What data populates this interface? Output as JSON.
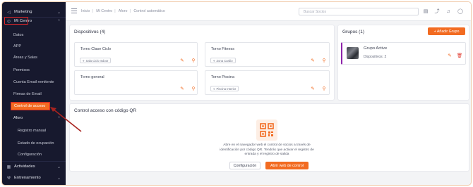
{
  "sidebar": {
    "marketing": "Marketing",
    "mi_centro": "Mi Centro",
    "items": [
      "Datos",
      "APP",
      "Áreas y Salas",
      "Permisos",
      "Cuenta Email remitente",
      "Firmas de Email"
    ],
    "control_acceso": "Control de acceso",
    "aforo": "Aforo",
    "aforo_items": [
      "Registro manual",
      "Estado de ocupación",
      "Configuración"
    ],
    "actividades": "Actividades",
    "entrenamiento": "Entrenamiento"
  },
  "topbar": {
    "breadcrumbs": [
      "Inicio",
      "Mi Centro",
      "Aforo",
      "Control automático"
    ],
    "search_placeholder": "Buscar Socios"
  },
  "dispositivos": {
    "title": "Dispositivos (4)",
    "cards": [
      {
        "name": "Torno Clase Ciclo",
        "tag": "Sala Ciclo Indoor"
      },
      {
        "name": "Torno Fitness",
        "tag": "Zona Cardio"
      },
      {
        "name": "Torno general",
        "tag": ""
      },
      {
        "name": "Torno Piscina",
        "tag": "Piscina Interior"
      }
    ]
  },
  "grupos": {
    "title": "Grupos (1)",
    "add_button": "+ Añadir Grupo",
    "group_name": "Grupo Active",
    "group_devices": "Dispositivos: 2"
  },
  "qr": {
    "title": "Control acceso con código QR",
    "description": "Abre en el navegador web el control de socios a través de identificación por código QR. Tendrás que activar el registro de entrada y el registro de salida",
    "config_button": "Configuración",
    "open_button": "Abrir web de control"
  },
  "colors": {
    "accent": "#f26b21",
    "sidebar_bg": "#17192e",
    "highlight_border": "#e0282a",
    "group_marker": "#8e24aa"
  }
}
